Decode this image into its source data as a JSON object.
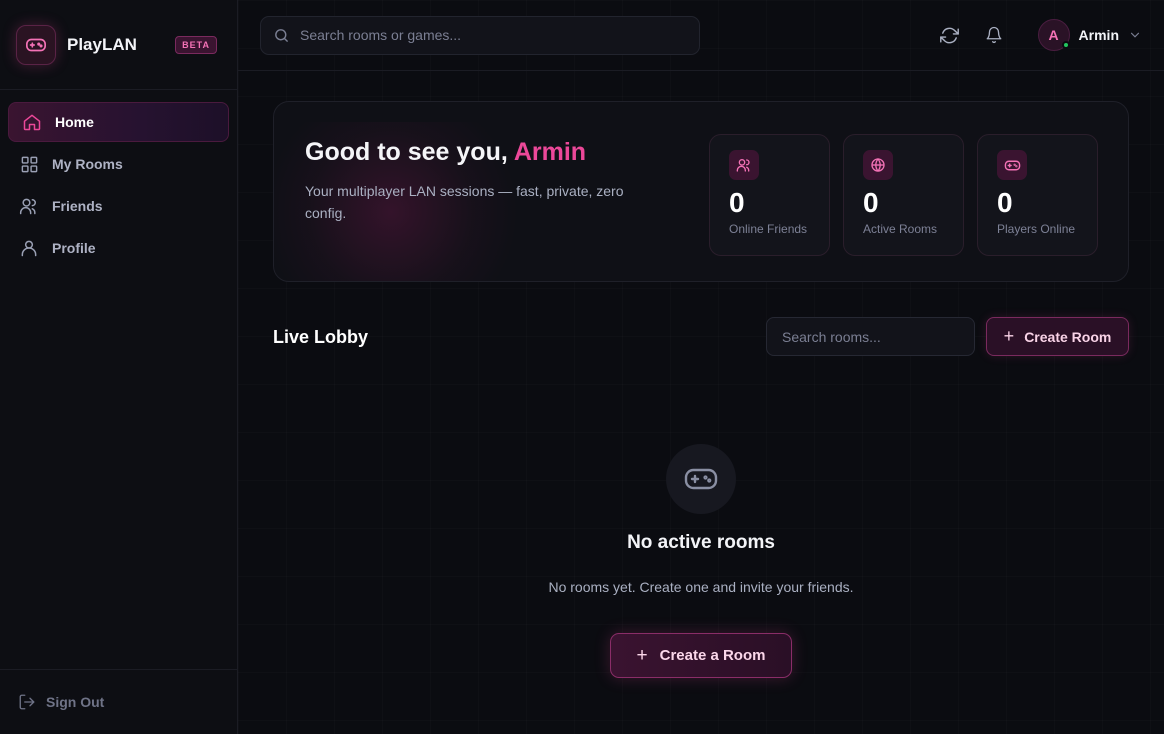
{
  "brand": {
    "name": "PlayLAN",
    "badge": "BETA",
    "logo_icon": "gamepad-icon"
  },
  "sidebar": {
    "items": [
      {
        "label": "Home",
        "icon": "home-icon",
        "active": true
      },
      {
        "label": "My Rooms",
        "icon": "grid-icon",
        "active": false
      },
      {
        "label": "Friends",
        "icon": "users-icon",
        "active": false
      },
      {
        "label": "Profile",
        "icon": "user-icon",
        "active": false
      }
    ],
    "signout_label": "Sign Out"
  },
  "topbar": {
    "search_placeholder": "Search rooms or games...",
    "user": {
      "initial": "A",
      "name": "Armin",
      "status": "online"
    }
  },
  "welcome": {
    "greeting": "Good to see you, ",
    "name": "Armin",
    "subtitle": "Your multiplayer LAN sessions — fast, private, zero config.",
    "stats": [
      {
        "value": "0",
        "label": "Online Friends",
        "icon": "users-icon"
      },
      {
        "value": "0",
        "label": "Active Rooms",
        "icon": "globe-icon"
      },
      {
        "value": "0",
        "label": "Players Online",
        "icon": "gamepad-icon"
      }
    ]
  },
  "lobby": {
    "title": "Live Lobby",
    "search_placeholder": "Search rooms...",
    "create_label": "Create Room",
    "empty_title": "No active rooms",
    "empty_subtitle": "No rooms yet. Create one and invite your friends.",
    "empty_cta": "Create a Room"
  },
  "colors": {
    "accent": "#ec4899",
    "background": "#0b0c11",
    "online": "#22c55e"
  }
}
